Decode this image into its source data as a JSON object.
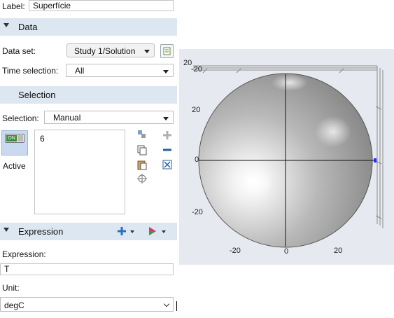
{
  "label": {
    "name": "Label:",
    "value": "Superfície"
  },
  "data_section": {
    "title": "Data"
  },
  "dataset": {
    "label": "Data set:",
    "value": "Study 1/Solution"
  },
  "time_selection": {
    "label": "Time selection:",
    "value": "All"
  },
  "selection_section": {
    "title": "Selection"
  },
  "selection": {
    "label": "Selection:",
    "value": "Manual",
    "toggle_text": "ON",
    "active_label": "Active",
    "items": [
      "6"
    ]
  },
  "expression_section": {
    "title": "Expression"
  },
  "expression": {
    "label": "Expression:",
    "value": "T"
  },
  "unit": {
    "label": "Unit:",
    "value": "degC"
  },
  "plot": {
    "tick_top_left_a": "20",
    "tick_top_left_b": "-20",
    "tick_y_20": "20",
    "tick_y_0": "0",
    "tick_y_m20": "-20",
    "tick_x_m20": "-20",
    "tick_x_0": "0",
    "tick_x_20": "20"
  },
  "colors": {
    "section_bg": "#dde7f2",
    "accent": "#2b6fc0",
    "graphics_bg": "#e6eaf0"
  }
}
